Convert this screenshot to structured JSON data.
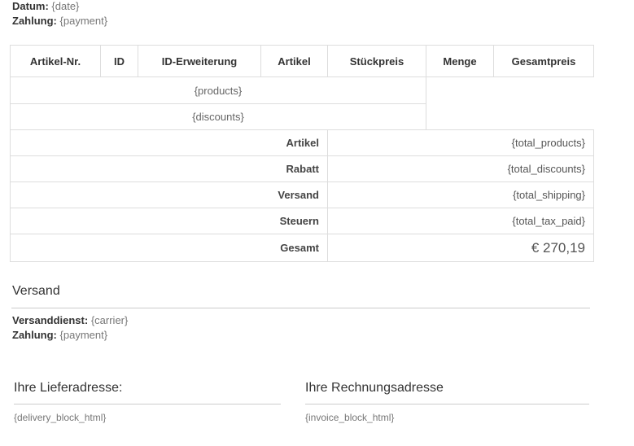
{
  "meta_top": {
    "date_label": "Datum:",
    "date_value": "{date}",
    "payment_label": "Zahlung:",
    "payment_value": "{payment}"
  },
  "table": {
    "headers": [
      "Artikel-Nr.",
      "ID",
      "ID-Erweiterung",
      "Artikel",
      "Stückpreis",
      "Menge",
      "Gesamtpreis"
    ],
    "products_placeholder": "{products}",
    "discounts_placeholder": "{discounts}",
    "totals": [
      {
        "label": "Artikel",
        "value": "{total_products}"
      },
      {
        "label": "Rabatt",
        "value": "{total_discounts}"
      },
      {
        "label": "Versand",
        "value": "{total_shipping}"
      },
      {
        "label": "Steuern",
        "value": "{total_tax_paid}"
      },
      {
        "label": "Gesamt",
        "value": "€ 270,19"
      }
    ]
  },
  "shipping": {
    "title": "Versand",
    "carrier_label": "Versanddienst:",
    "carrier_value": "{carrier}",
    "payment_label": "Zahlung:",
    "payment_value": "{payment}"
  },
  "addresses": {
    "delivery_title": "Ihre Lieferadresse:",
    "delivery_value": "{delivery_block_html}",
    "invoice_title": "Ihre Rechnungsadresse",
    "invoice_value": "{invoice_block_html}"
  }
}
